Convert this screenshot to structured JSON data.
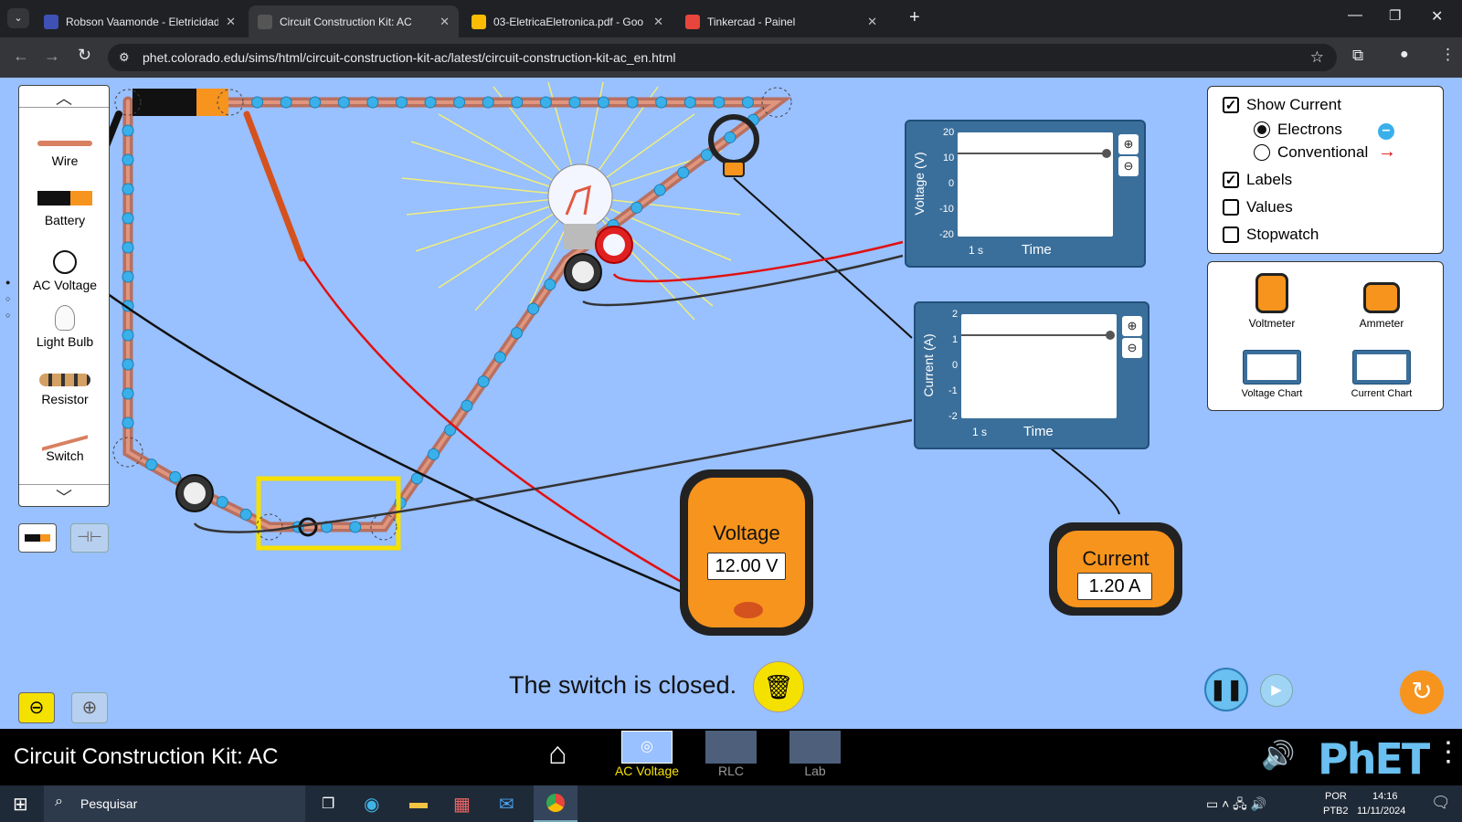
{
  "browser": {
    "tabs": [
      {
        "title": "Robson Vaamonde - Eletricidad",
        "active": false,
        "fav_color": "#3f51b5"
      },
      {
        "title": "Circuit Construction Kit: AC",
        "active": true,
        "fav_color": "#555555"
      },
      {
        "title": "03-EletricaEletronica.pdf - Goo",
        "active": false,
        "fav_color": "#fbbc04"
      },
      {
        "title": "Tinkercad - Painel",
        "active": false,
        "fav_color": "#e8453c"
      }
    ],
    "url": "phet.colorado.edu/sims/html/circuit-construction-kit-ac/latest/circuit-construction-kit-ac_en.html"
  },
  "toolbox": {
    "items": [
      {
        "label": "Wire",
        "icon": "wire-icon"
      },
      {
        "label": "Battery",
        "icon": "battery-icon"
      },
      {
        "label": "AC Voltage",
        "icon": "ac-source-icon"
      },
      {
        "label": "Light Bulb",
        "icon": "light-bulb-icon"
      },
      {
        "label": "Resistor",
        "icon": "resistor-icon"
      },
      {
        "label": "Switch",
        "icon": "switch-icon"
      }
    ]
  },
  "controls": {
    "show_current": {
      "label": "Show Current",
      "checked": true
    },
    "electrons": {
      "label": "Electrons",
      "selected": true
    },
    "conventional": {
      "label": "Conventional",
      "selected": false
    },
    "labels": {
      "label": "Labels",
      "checked": true
    },
    "values": {
      "label": "Values",
      "checked": false
    },
    "stopwatch": {
      "label": "Stopwatch",
      "checked": false
    }
  },
  "sensors": {
    "voltmeter": "Voltmeter",
    "ammeter": "Ammeter",
    "voltage_chart": "Voltage Chart",
    "current_chart": "Current Chart"
  },
  "voltage_chart": {
    "ylabel": "Voltage (V)",
    "ticks": [
      "20",
      "10",
      "0",
      "-10",
      "-20"
    ],
    "scale": "1 s",
    "xlabel": "Time"
  },
  "current_chart": {
    "ylabel": "Current (A)",
    "ticks": [
      "2",
      "1",
      "0",
      "-1",
      "-2"
    ],
    "scale": "1 s",
    "xlabel": "Time"
  },
  "voltmeter": {
    "title": "Voltage",
    "value": "12.00 V"
  },
  "ammeter": {
    "title": "Current",
    "value": "1.20 A"
  },
  "status_text": "The switch is closed.",
  "sim_title": "Circuit Construction Kit: AC",
  "screens": [
    {
      "label": "AC Voltage",
      "active": true
    },
    {
      "label": "RLC",
      "active": false
    },
    {
      "label": "Lab",
      "active": false
    }
  ],
  "taskbar": {
    "search": "Pesquisar",
    "lang1": "POR",
    "lang2": "PTB2",
    "time": "14:16",
    "date": "11/11/2024"
  },
  "colors": {
    "accent_yellow": "#f5e100",
    "meter_orange": "#f7941d",
    "chart_blue": "#3b6f9b",
    "electron": "#3ab0ea"
  }
}
